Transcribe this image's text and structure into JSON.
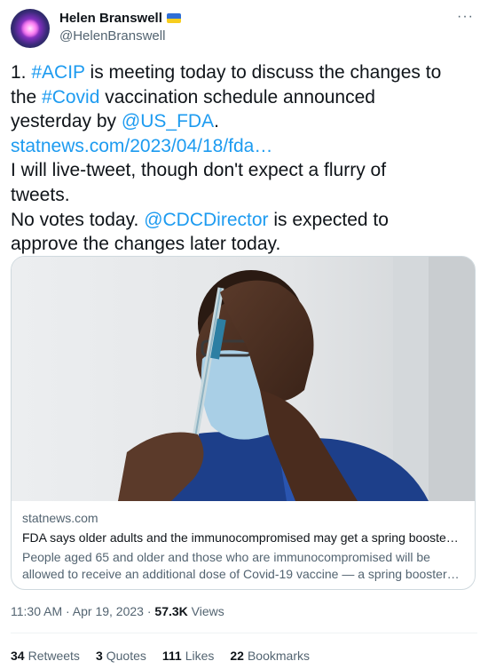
{
  "author": {
    "display_name": "Helen Branswell",
    "handle": "@HelenBranswell",
    "badge_icon": "ukraine-flag-icon"
  },
  "menu": {
    "more_label": "···"
  },
  "tweet": {
    "lines": [
      [
        {
          "t": "1. "
        },
        {
          "t": "#ACIP",
          "link": true
        },
        {
          "t": " is meeting today to discuss the changes to"
        }
      ],
      [
        {
          "t": "the "
        },
        {
          "t": "#Covid",
          "link": true
        },
        {
          "t": " vaccination schedule announced"
        }
      ],
      [
        {
          "t": "yesterday by "
        },
        {
          "t": "@US_FDA",
          "link": true
        },
        {
          "t": "."
        }
      ],
      [
        {
          "t": "statnews.com/2023/04/18/fda…",
          "link": true
        }
      ],
      [
        {
          "t": "I will live-tweet, though don't expect a flurry of"
        }
      ],
      [
        {
          "t": "tweets."
        }
      ],
      [
        {
          "t": "No votes today. "
        },
        {
          "t": "@CDCDirector",
          "link": true
        },
        {
          "t": " is expected to"
        }
      ],
      [
        {
          "t": "approve the changes later today."
        }
      ]
    ]
  },
  "card": {
    "domain": "statnews.com",
    "title": "FDA says older adults and the immunocompromised may get a spring booste…",
    "description_line1": "People aged 65 and older and those who are immunocompromised will be",
    "description_line2": "allowed to receive an additional dose of Covid-19 vaccine — a spring booster…"
  },
  "meta": {
    "time": "11:30 AM · Apr 19, 2023 · ",
    "views_count": "57.3K",
    "views_label": " Views"
  },
  "stats": [
    {
      "count": "34",
      "label": "Retweets"
    },
    {
      "count": "3",
      "label": "Quotes"
    },
    {
      "count": "111",
      "label": "Likes"
    },
    {
      "count": "22",
      "label": "Bookmarks"
    }
  ],
  "colors": {
    "link": "#1d9bf0",
    "text": "#0f1419",
    "secondary": "#536471",
    "border": "#cfd9de"
  }
}
